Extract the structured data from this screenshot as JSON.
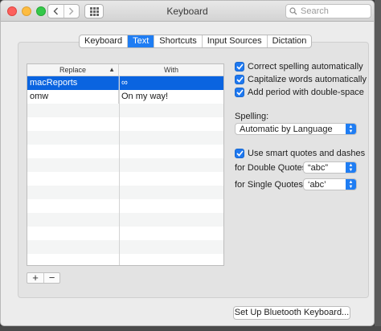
{
  "window": {
    "title": "Keyboard"
  },
  "search": {
    "placeholder": "Search"
  },
  "tabs": [
    {
      "label": "Keyboard",
      "active": false
    },
    {
      "label": "Text",
      "active": true
    },
    {
      "label": "Shortcuts",
      "active": false
    },
    {
      "label": "Input Sources",
      "active": false
    },
    {
      "label": "Dictation",
      "active": false
    }
  ],
  "table": {
    "headers": {
      "replace": "Replace",
      "with": "With"
    },
    "rows": [
      {
        "replace": "macReports",
        "with": "∞",
        "selected": true
      },
      {
        "replace": "omw",
        "with": "On my way!",
        "selected": false
      }
    ]
  },
  "controls": {
    "add": "+",
    "remove": "−"
  },
  "options": {
    "correct_spelling": {
      "label": "Correct spelling automatically",
      "checked": true
    },
    "capitalize": {
      "label": "Capitalize words automatically",
      "checked": true
    },
    "period": {
      "label": "Add period with double-space",
      "checked": true
    },
    "spelling_label": "Spelling:",
    "spelling_value": "Automatic by Language",
    "smart_quotes": {
      "label": "Use smart quotes and dashes",
      "checked": true
    },
    "double_label": "for Double Quotes",
    "double_value": "“abc”",
    "single_label": "for Single Quotes",
    "single_value": "‘abc’"
  },
  "bluetooth_button": "Set Up Bluetooth Keyboard...",
  "colors": {
    "accent": "#1f7df3",
    "selection": "#0a64e0"
  }
}
